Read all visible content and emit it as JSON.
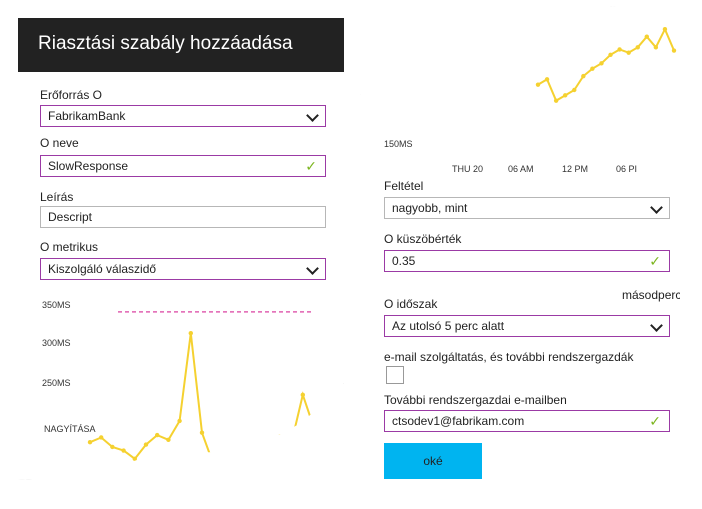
{
  "left": {
    "title": "Riasztási szabály hozzáadása",
    "resource_label": "Erőforrás O",
    "resource_value": "FabrikamBank",
    "name_label": "O neve",
    "name_value": "SlowResponse",
    "desc_label": "Leírás",
    "desc_value": "Descript",
    "metric_label": "O metrikus",
    "metric_value": "Kiszolgáló válaszidő",
    "zoom_label": "NAGYÍTÁSA",
    "chart_data": {
      "type": "line",
      "y_tick_labels": [
        "350MS",
        "300MS",
        "250MS"
      ],
      "y_ticks": [
        350,
        300,
        250
      ],
      "ylim": [
        225,
        360
      ],
      "threshold": 350,
      "values": [
        240,
        244,
        236,
        233,
        226,
        238,
        246,
        242,
        258,
        332,
        248,
        222,
        218,
        226,
        220,
        224,
        232,
        245,
        240,
        280,
        252
      ],
      "color": "#f5d130",
      "threshold_color": "#e060b0"
    }
  },
  "right": {
    "y_tick_label": "150MS",
    "x_tick_labels": [
      "THU 20",
      "06 AM",
      "12 PM",
      "06 PI"
    ],
    "chart_data": {
      "type": "line",
      "values": [
        210,
        215,
        195,
        200,
        205,
        218,
        225,
        230,
        238,
        243,
        240,
        245,
        255,
        245,
        262,
        242
      ],
      "ylim": [
        160,
        265
      ],
      "color": "#f5d130"
    },
    "condition_label": "Feltétel",
    "condition_value": "nagyobb, mint",
    "threshold_label": "O küszöbérték",
    "threshold_value": "0.35",
    "seconds_label": "másodperc",
    "period_label": "O időszak",
    "period_value": "Az utolsó 5 perc alatt",
    "email_owners_label": "e-mail szolgáltatás, és további rendszergazdák",
    "extra_email_label": "További rendszergazdai e-mailben",
    "extra_email_value": "ctsodev1@fabrikam.com",
    "ok_label": "oké"
  }
}
